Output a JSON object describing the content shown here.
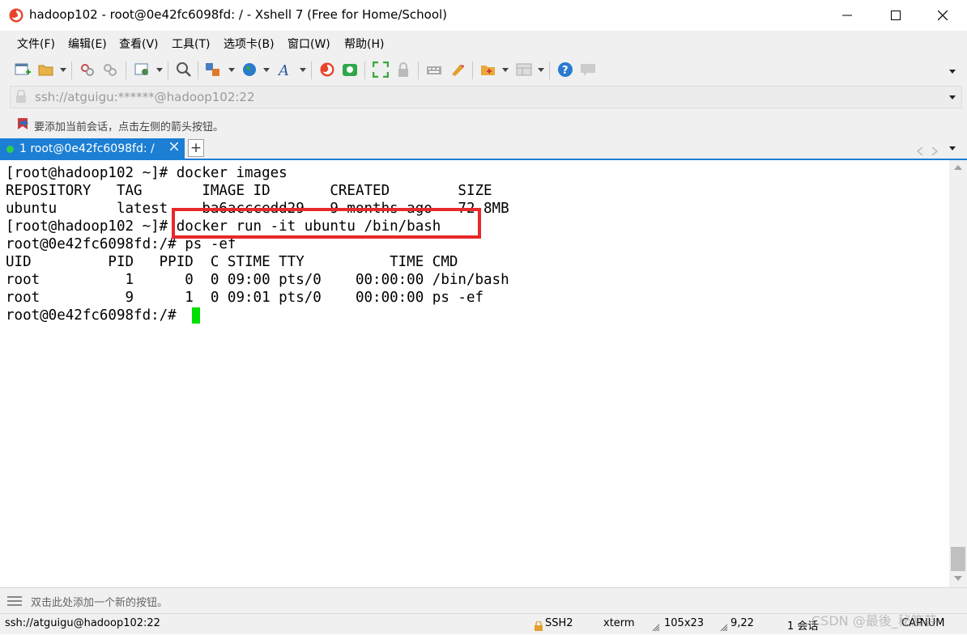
{
  "window": {
    "title": "hadoop102 - root@0e42fc6098fd: / - Xshell 7 (Free for Home/School)",
    "controls": [
      "minimize",
      "maximize",
      "close"
    ]
  },
  "menu": {
    "items": [
      "文件(F)",
      "编辑(E)",
      "查看(V)",
      "工具(T)",
      "选项卡(B)",
      "窗口(W)",
      "帮助(H)"
    ]
  },
  "toolbar": {
    "icons": [
      "new-session-icon",
      "open-folder-icon",
      "disconnect-icon",
      "reconnect-icon",
      "properties-icon",
      "find-icon",
      "transfer-icon",
      "globe-icon",
      "font-icon",
      "xshell-icon",
      "xftp-icon",
      "fullscreen-icon",
      "lock-icon",
      "keyboard-icon",
      "highlight-icon",
      "new-folder-icon",
      "layout-icon",
      "help-icon",
      "chat-icon"
    ]
  },
  "address": {
    "value": "ssh://atguigu:******@hadoop102:22"
  },
  "quickbar": {
    "hint": "要添加当前会话，点击左侧的箭头按钮。"
  },
  "tabs": [
    {
      "label": "1 root@0e42fc6098fd: /",
      "active": true
    }
  ],
  "terminal": {
    "lines": [
      "[root@hadoop102 ~]# docker images",
      "REPOSITORY   TAG       IMAGE ID       CREATED        SIZE",
      "ubuntu       latest    ba6acccedd29   9 months ago   72.8MB",
      "[root@hadoop102 ~]# docker run -it ubuntu /bin/bash",
      "root@0e42fc6098fd:/# ps -ef",
      "UID         PID   PPID  C STIME TTY          TIME CMD",
      "root          1      0  0 09:00 pts/0    00:00:00 /bin/bash",
      "root          9      1  0 09:01 pts/0    00:00:00 ps -ef",
      "root@0e42fc6098fd:/# "
    ],
    "highlight_color": "#e8282a",
    "cursor_color": "#00e000"
  },
  "compose": {
    "hint": "双击此处添加一个新的按钮。"
  },
  "status": {
    "connection": "ssh://atguigu@hadoop102:22",
    "protocol": "SSH2",
    "terminal_type": "xterm",
    "size": "105x23",
    "position": "9,22",
    "sessions": "1 会话",
    "caps": "CAP",
    "num": "NUM",
    "watermark": "CSDN @最後_秘笈芸"
  },
  "colors": {
    "accent": "#1c7fd4",
    "chrome": "#f0f0f0"
  }
}
